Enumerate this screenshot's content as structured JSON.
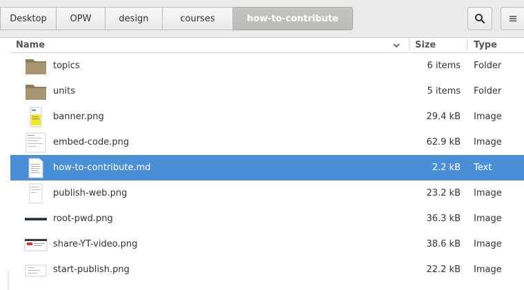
{
  "pathbar": {
    "crumbs": [
      {
        "label": "Desktop"
      },
      {
        "label": "OPW"
      },
      {
        "label": "design"
      },
      {
        "label": "courses"
      },
      {
        "label": "how-to-contribute"
      }
    ]
  },
  "toolbar": {
    "search_icon": "search-icon",
    "menu_icon": "menu-icon"
  },
  "columns": {
    "name": "Name",
    "size": "Size",
    "type": "Type",
    "sort_indicator": "chevron-down-icon"
  },
  "files": [
    {
      "name": "topics",
      "size": "6 items",
      "type": "Folder",
      "icon": "folder-icon"
    },
    {
      "name": "units",
      "size": "5 items",
      "type": "Folder",
      "icon": "folder-icon"
    },
    {
      "name": "banner.png",
      "size": "29.4 kB",
      "type": "Image",
      "icon": "image-thumbnail-icon"
    },
    {
      "name": "embed-code.png",
      "size": "62.9 kB",
      "type": "Image",
      "icon": "image-thumbnail-icon"
    },
    {
      "name": "how-to-contribute.md",
      "size": "2.2 kB",
      "type": "Text",
      "icon": "text-document-icon",
      "selected": true
    },
    {
      "name": "publish-web.png",
      "size": "23.2 kB",
      "type": "Image",
      "icon": "image-thumbnail-icon"
    },
    {
      "name": "root-pwd.png",
      "size": "36.3 kB",
      "type": "Image",
      "icon": "image-thumbnail-icon"
    },
    {
      "name": "share-YT-video.png",
      "size": "38.6 kB",
      "type": "Image",
      "icon": "image-thumbnail-icon"
    },
    {
      "name": "start-publish.png",
      "size": "22.2 kB",
      "type": "Image",
      "icon": "image-thumbnail-icon"
    }
  ],
  "colors": {
    "selection": "#4a90d9",
    "folder": "#a08d6e"
  }
}
